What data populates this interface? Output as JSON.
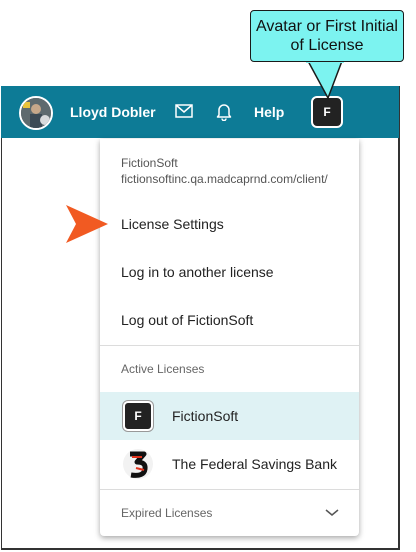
{
  "callout": {
    "text_line1": "Avatar or First Initial",
    "text_line2": "of License"
  },
  "topbar": {
    "user_name": "Lloyd Dobler",
    "help_label": "Help",
    "license_initial": "F",
    "icons": [
      "avatar-photo",
      "mail-icon",
      "bell-icon"
    ],
    "background": "#0d7b96"
  },
  "dropdown": {
    "org_name": "FictionSoft",
    "org_url": "fictionsoftinc.qa.madcaprnd.com/client/",
    "items": [
      "License Settings",
      "Log in to another license",
      "Log out of FictionSoft"
    ],
    "active_label": "Active Licenses",
    "licenses": [
      {
        "initial": "F",
        "name": "FictionSoft",
        "selected": true
      },
      {
        "logo": "federal-savings-logo",
        "name": "The Federal Savings Bank",
        "selected": false
      }
    ],
    "expired_label": "Expired Licenses",
    "selected_bg": "#dff2f4"
  },
  "pointer": {
    "color": "#f15a22"
  }
}
